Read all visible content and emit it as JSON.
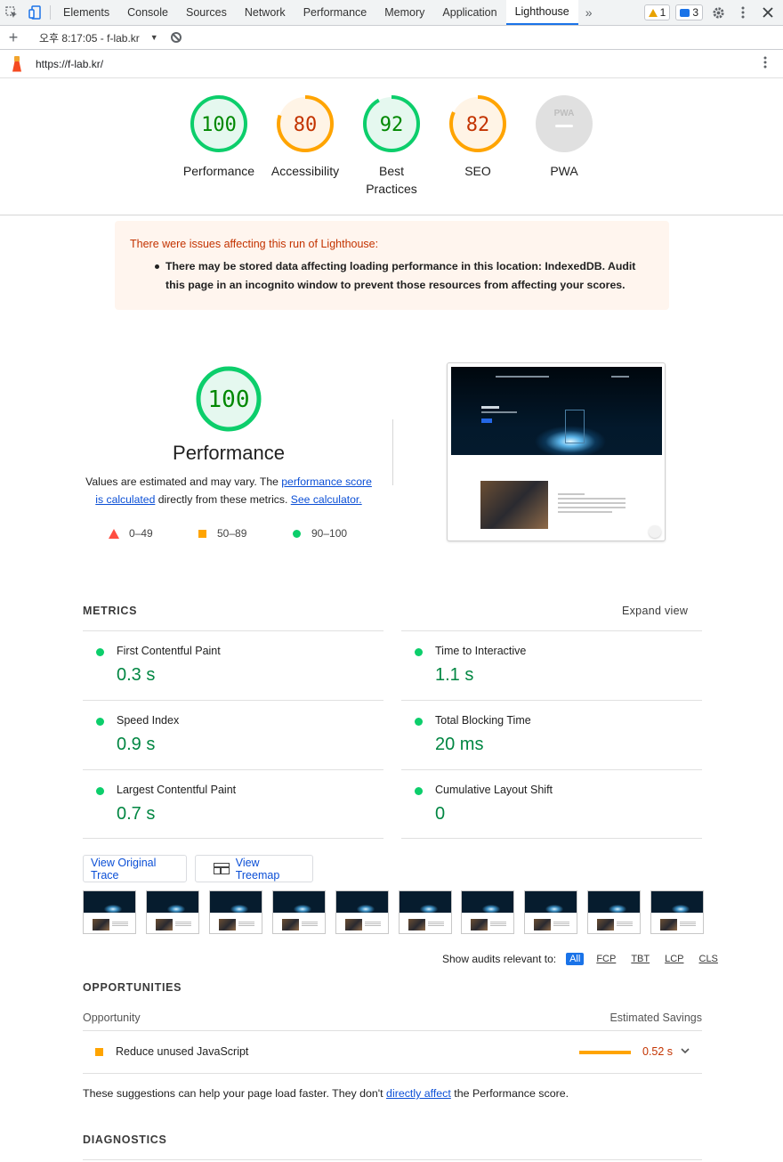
{
  "devtools": {
    "tabs": [
      "Elements",
      "Console",
      "Sources",
      "Network",
      "Performance",
      "Memory",
      "Application",
      "Lighthouse"
    ],
    "active_tab": "Lighthouse",
    "more_tabs": "»",
    "warnings_count": "1",
    "messages_count": "3"
  },
  "toolbar": {
    "report_label": "오후 8:17:05 - f-lab.kr"
  },
  "urlbar": {
    "url": "https://f-lab.kr/"
  },
  "gauges": [
    {
      "label": "Performance",
      "score": "100",
      "status": "pass",
      "color": "#0cce6b",
      "fraction": 1.0
    },
    {
      "label": "Accessibility",
      "score": "80",
      "status": "average",
      "color": "#ffa400",
      "fraction": 0.8
    },
    {
      "label": "Best Practices",
      "score": "92",
      "status": "pass",
      "color": "#0cce6b",
      "fraction": 0.92
    },
    {
      "label": "SEO",
      "score": "82",
      "status": "average",
      "color": "#ffa400",
      "fraction": 0.82
    },
    {
      "label": "PWA",
      "score": "PWA",
      "status": "na",
      "color": "#cccccc",
      "fraction": 0
    }
  ],
  "warning": {
    "heading": "There were issues affecting this run of Lighthouse:",
    "item": "There may be stored data affecting loading performance in this location: IndexedDB. Audit this page in an incognito window to prevent those resources from affecting your scores."
  },
  "performance": {
    "score": "100",
    "title": "Performance",
    "desc_prefix": "Values are estimated and may vary. The ",
    "desc_link1": "performance score is calculated",
    "desc_mid": " directly from these metrics. ",
    "desc_link2": "See calculator.",
    "legend": [
      {
        "range": "0–49",
        "shape": "triangle",
        "color": "#ff4e42"
      },
      {
        "range": "50–89",
        "shape": "square",
        "color": "#ffa400"
      },
      {
        "range": "90–100",
        "shape": "circle",
        "color": "#0cce6b"
      }
    ]
  },
  "metrics": {
    "heading": "METRICS",
    "expand": "Expand view",
    "left": [
      {
        "name": "First Contentful Paint",
        "value": "0.3 s"
      },
      {
        "name": "Speed Index",
        "value": "0.9 s"
      },
      {
        "name": "Largest Contentful Paint",
        "value": "0.7 s"
      }
    ],
    "right": [
      {
        "name": "Time to Interactive",
        "value": "1.1 s"
      },
      {
        "name": "Total Blocking Time",
        "value": "20 ms"
      },
      {
        "name": "Cumulative Layout Shift",
        "value": "0"
      }
    ]
  },
  "buttons": {
    "trace": "View Original Trace",
    "treemap": "View Treemap"
  },
  "filmstrip_count": 10,
  "audit_filter": {
    "label": "Show audits relevant to:",
    "chips": [
      "All",
      "FCP",
      "TBT",
      "LCP",
      "CLS"
    ],
    "active": "All"
  },
  "opportunities": {
    "heading": "OPPORTUNITIES",
    "col_left": "Opportunity",
    "col_right": "Estimated Savings",
    "items": [
      {
        "title": "Reduce unused JavaScript",
        "savings": "0.52 s"
      }
    ]
  },
  "note": {
    "prefix": "These suggestions can help your page load faster. They don't ",
    "link": "directly affect",
    "suffix": " the Performance score."
  },
  "diagnostics": {
    "heading": "DIAGNOSTICS"
  }
}
